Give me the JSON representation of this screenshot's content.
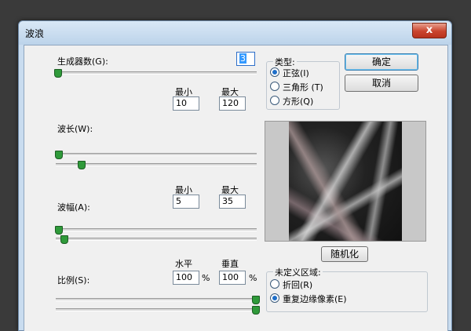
{
  "window": {
    "title": "波浪",
    "close_glyph": "x"
  },
  "generators": {
    "label": "生成器数(G):",
    "value": "3",
    "slider_fraction": 0.01
  },
  "wavelength": {
    "label": "波长(W):",
    "min_header": "最小",
    "max_header": "最大",
    "min": "10",
    "max": "120",
    "slider_min_fraction": 0.01,
    "slider_max_fraction": 0.12
  },
  "amplitude": {
    "label": "波幅(A):",
    "min_header": "最小",
    "max_header": "最大",
    "min": "5",
    "max": "35",
    "slider_min_fraction": 0.01,
    "slider_max_fraction": 0.04
  },
  "scale": {
    "label": "比例(S):",
    "horizontal_header": "水平",
    "vertical_header": "垂直",
    "horizontal": "100",
    "vertical": "100",
    "unit": "%",
    "slider_h_fraction": 1.0,
    "slider_v_fraction": 1.0
  },
  "type_group": {
    "title": "类型:",
    "options": [
      "正弦(I)",
      "三角形 (T)",
      "方形(Q)"
    ],
    "selected_index": 0
  },
  "buttons": {
    "ok": "确定",
    "cancel": "取消",
    "randomize": "随机化"
  },
  "undefined_areas": {
    "title": "未定义区域:",
    "options": [
      "折回(R)",
      "重复边缘像素(E)"
    ],
    "selected_index": 1
  },
  "colors": {
    "slider_thumb": "#2f9a3a",
    "close_button": "#c9432d"
  }
}
